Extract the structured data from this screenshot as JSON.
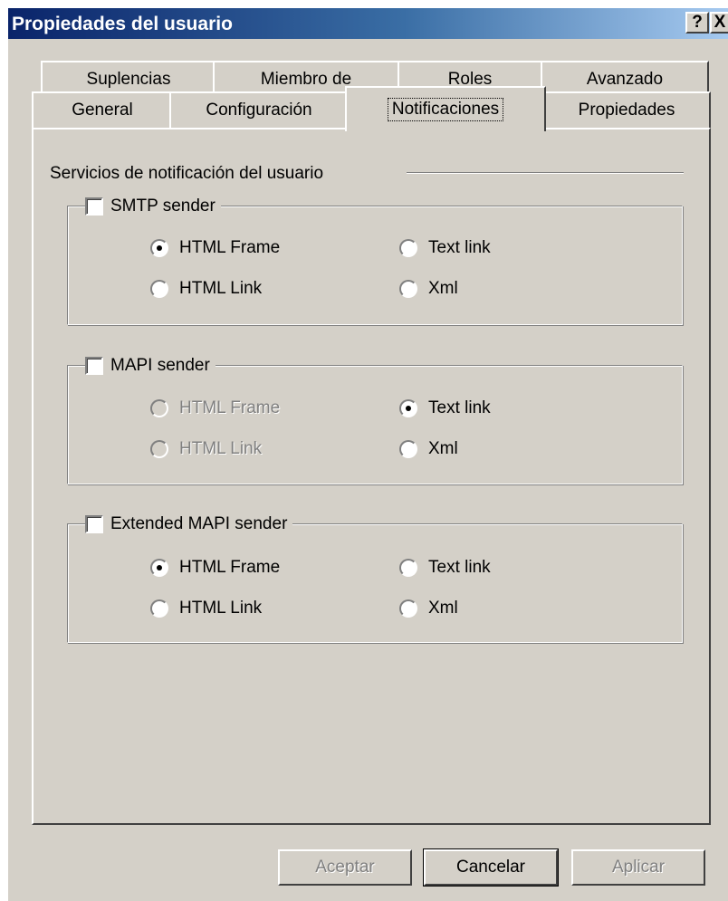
{
  "window": {
    "title": "Propiedades del usuario",
    "help_label": "?",
    "close_label": "X"
  },
  "tabs": {
    "row1": [
      "Suplencias",
      "Miembro de",
      "Roles",
      "Avanzado"
    ],
    "row2": [
      "General",
      "Configuración",
      "Notificaciones",
      "Propiedades"
    ],
    "active": "Notificaciones"
  },
  "section": {
    "title": "Servicios de notificación del usuario"
  },
  "groups": [
    {
      "label": "SMTP sender",
      "checked": false,
      "options": [
        {
          "label": "HTML Frame",
          "selected": true,
          "disabled": false
        },
        {
          "label": "Text link",
          "selected": false,
          "disabled": false
        },
        {
          "label": "HTML Link",
          "selected": false,
          "disabled": false
        },
        {
          "label": "Xml",
          "selected": false,
          "disabled": false
        }
      ]
    },
    {
      "label": "MAPI sender",
      "checked": false,
      "options": [
        {
          "label": "HTML Frame",
          "selected": false,
          "disabled": true
        },
        {
          "label": "Text link",
          "selected": true,
          "disabled": false
        },
        {
          "label": "HTML Link",
          "selected": false,
          "disabled": true
        },
        {
          "label": "Xml",
          "selected": false,
          "disabled": false
        }
      ]
    },
    {
      "label": "Extended MAPI sender",
      "checked": false,
      "options": [
        {
          "label": "HTML Frame",
          "selected": true,
          "disabled": false
        },
        {
          "label": "Text link",
          "selected": false,
          "disabled": false
        },
        {
          "label": "HTML Link",
          "selected": false,
          "disabled": false
        },
        {
          "label": "Xml",
          "selected": false,
          "disabled": false
        }
      ]
    }
  ],
  "buttons": {
    "accept": "Aceptar",
    "cancel": "Cancelar",
    "apply": "Aplicar"
  }
}
